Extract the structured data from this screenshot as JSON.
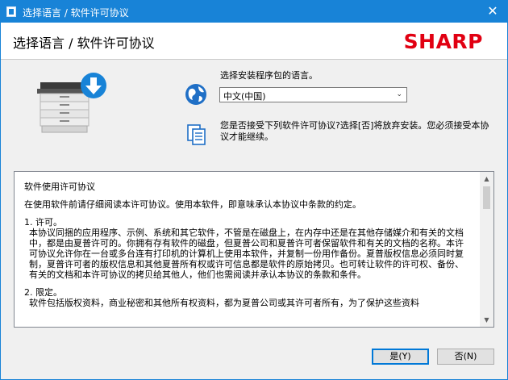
{
  "window": {
    "title": "选择语言 / 软件许可协议",
    "close_glyph": "✕"
  },
  "header": {
    "heading": "选择语言 / 软件许可协议",
    "logo": "SHARP",
    "brand_color": "#e10012"
  },
  "language": {
    "label": "选择安装程序包的语言。",
    "selected": "中文(中国)",
    "chevron_glyph": "⌄"
  },
  "agreement": {
    "prompt": "您是否接受下列软件许可协议?选择[否]将放弃安装。您必须接受本协议才能继续。"
  },
  "license": {
    "title": "软件使用许可协议",
    "intro": "在使用软件前请仔细阅读本许可协议。使用本软件，即意味承认本协议中条款的约定。",
    "section1_heading": "1. 许可。",
    "section1_body": "本协议同捆的应用程序、示例、系统和其它软件，不管是在磁盘上，在内存中还是在其他存储媒介和有关的文档中，都是由夏普许可的。你拥有存有软件的磁盘，但夏普公司和夏普许可者保留软件和有关的文档的名称。本许可协议允许你在一台或多台连有打印机的计算机上使用本软件，并复制一份用作备份。夏普版权信息必须同时复制，夏普许可者的版权信息和其他夏普所有权或许可信息都是软件的原始拷贝。也可转让软件的许可权、备份、有关的文档和本许可协议的拷贝给其他人，他们也需阅读并承认本协议的条款和条件。",
    "section2_heading": "2. 限定。",
    "section2_body": "软件包括版权资料，商业秘密和其他所有权资料，都为夏普公司或其许可者所有，为了保护这些资料"
  },
  "buttons": {
    "yes": "是(Y)",
    "no": "否(N)"
  },
  "colors": {
    "titlebar": "#1883d7",
    "dialog_bg": "#f0f0f0"
  }
}
